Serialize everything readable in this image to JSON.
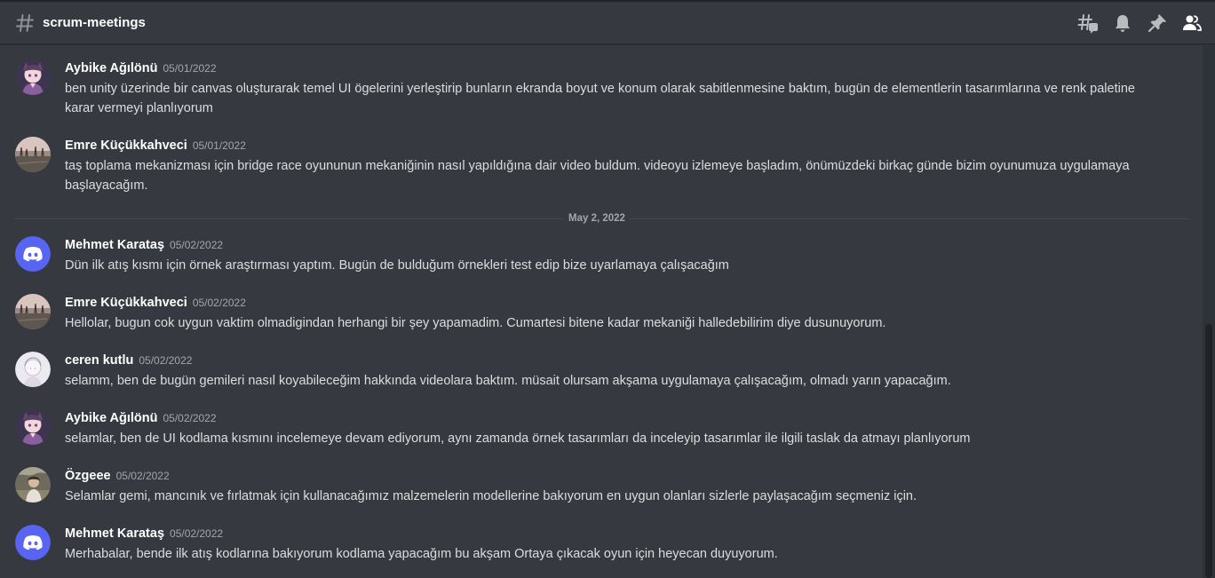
{
  "channel": {
    "name": "scrum-meetings",
    "header_icons": [
      "threads-icon",
      "bell-icon",
      "pin-icon",
      "members-icon"
    ]
  },
  "messages": [
    {
      "author": "Aybike Ağılönü",
      "timestamp": "05/01/2022",
      "text": "ben unity üzerinde bir canvas oluşturarak temel UI ögelerini yerleştirip bunların ekranda boyut ve konum olarak sabitlenmesine baktım, bugün de elementlerin tasarımlarına ve renk paletine karar vermeyi planlıyorum",
      "avatar": "anime-character-avatar"
    },
    {
      "author": "Emre Küçükkahveci",
      "timestamp": "05/01/2022",
      "text": "taş toplama mekanizması için bridge race oyununun mekaniğinin nasıl yapıldığına dair video buldum. videoyu izlemeye başladım, önümüzdeki birkaç günde bizim oyunumuza uygulamaya başlayacağım.",
      "avatar": "landscape-photo-avatar"
    },
    {
      "author": "Mehmet Karataş",
      "timestamp": "05/02/2022",
      "text": "Dün ilk atış kısmı için örnek araştırması yaptım. Bugün de bulduğum örnekleri test edip bize uyarlamaya çalışacağım",
      "avatar": "discord-default-avatar"
    },
    {
      "author": "Emre Küçükkahveci",
      "timestamp": "05/02/2022",
      "text": "Hellolar, bugun cok uygun vaktim olmadigindan herhangi bir şey yapamadim. Cumartesi bitene kadar mekaniği halledebilirim diye dusunuyorum.",
      "avatar": "landscape-photo-avatar"
    },
    {
      "author": "ceren kutlu",
      "timestamp": "05/02/2022",
      "text": "selamm, ben de bugün gemileri nasıl koyabileceğim hakkında videolara baktım. müsait olursam akşama uygulamaya çalışacağım, olmadı yarın yapacağım.",
      "avatar": "sketch-avatar"
    },
    {
      "author": "Aybike Ağılönü",
      "timestamp": "05/02/2022",
      "text": "selamlar, ben de UI kodlama kısmını incelemeye devam ediyorum, aynı zamanda örnek tasarımları da inceleyip tasarımlar ile ilgili taslak da atmayı planlıyorum",
      "avatar": "anime-character-avatar"
    },
    {
      "author": "Özgeee",
      "timestamp": "05/02/2022",
      "text": "Selamlar gemi, mancınık ve fırlatmak için kullanacağımız malzemelerin modellerine bakıyorum en uygun olanları sizlerle paylaşacağım seçmeniz için.",
      "avatar": "portrait-photo-avatar"
    },
    {
      "author": "Mehmet Karataş",
      "timestamp": "05/02/2022",
      "text": "Merhabalar, bende ilk atış kodlarına bakıyorum kodlama yapacağım bu akşam Ortaya çıkacak oyun için heyecan duyuyorum.",
      "avatar": "discord-default-avatar"
    }
  ],
  "date_divider": "May 2, 2022",
  "colors": {
    "background": "#36393f",
    "header_border": "#202225",
    "author": "#ffffff",
    "text": "#dcddde",
    "muted": "#a3a6aa",
    "discord_blurple": "#5865f2",
    "icon": "#b9bbbe"
  }
}
